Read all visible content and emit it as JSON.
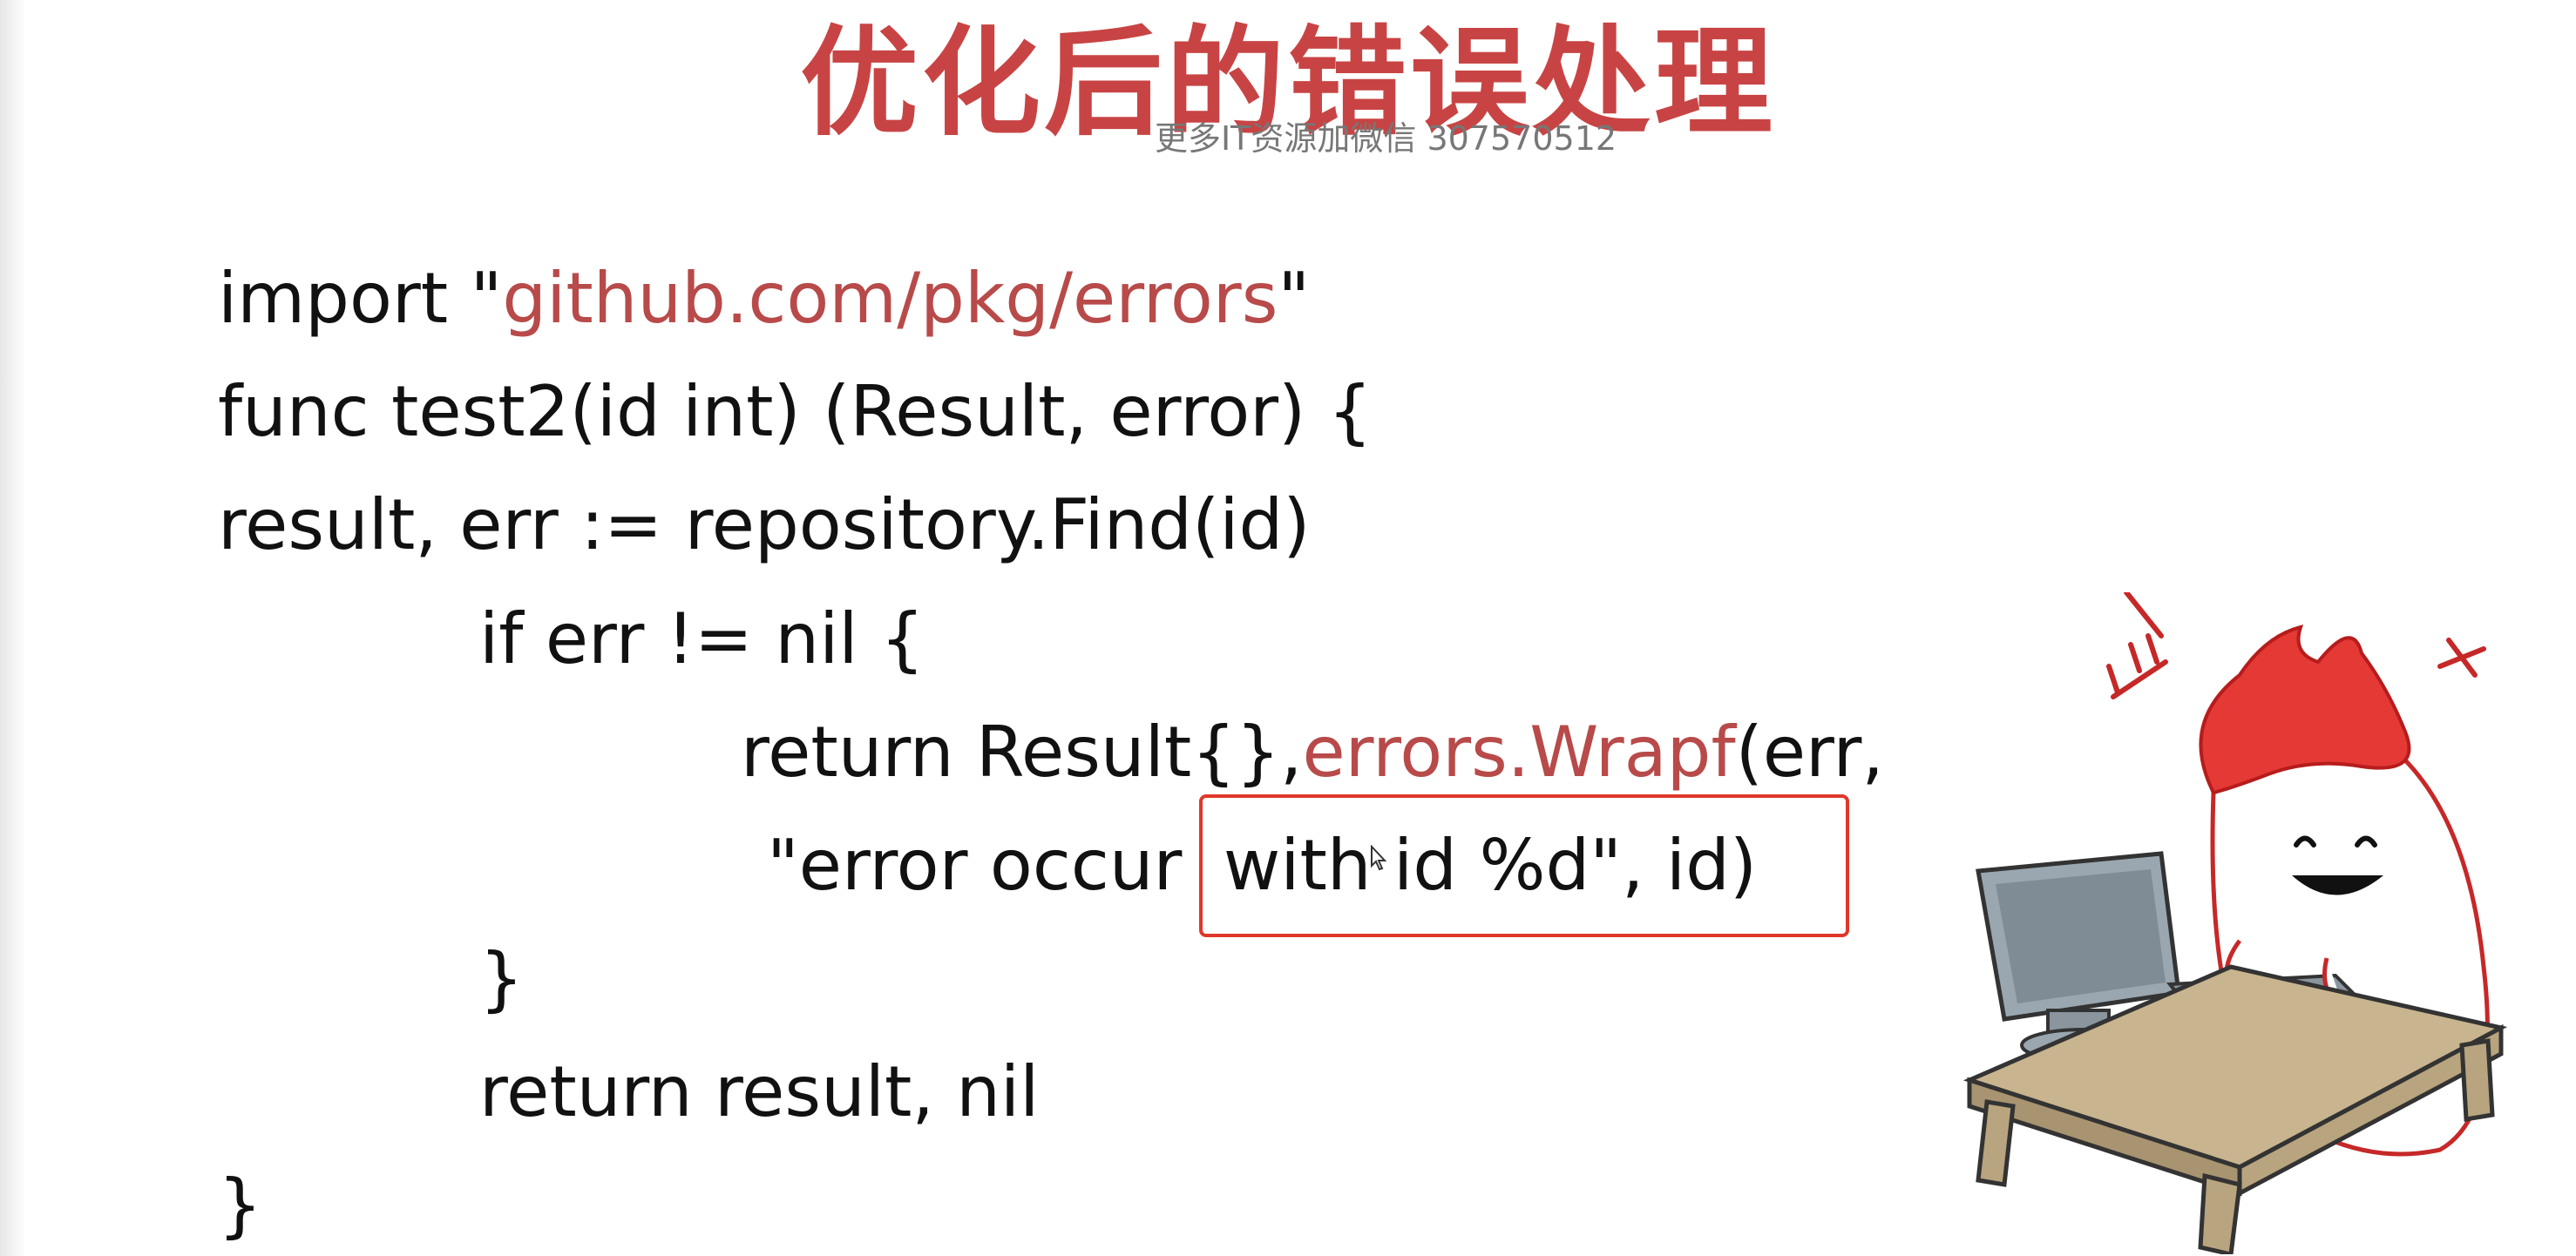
{
  "slide": {
    "title": "优化后的错误处理",
    "watermark": "更多IT资源加微信 307570512",
    "code": {
      "line1": {
        "kw": "import \"",
        "pkg": "github.com/pkg/errors",
        "end": "\""
      },
      "line2": "func test2(id int) (Result, error) {",
      "line3": "result, err := repository.Find(id)",
      "line4": "if err != nil {",
      "line5": {
        "pre": "return Result{},",
        "fn": "errors.Wrapf",
        "post": "(err,"
      },
      "line6": {
        "pre": "\"error occur ",
        "boxed": "with id %d\", id)"
      },
      "line7": "}",
      "line8": "return result, nil",
      "line9": "}"
    },
    "highlight_color": "#e0372b",
    "title_color": "#c84444",
    "string_color": "#b84a4a"
  },
  "icons": {
    "cursor": "mouse-pointer-icon",
    "mascot": "mascot-at-computer-illustration"
  }
}
